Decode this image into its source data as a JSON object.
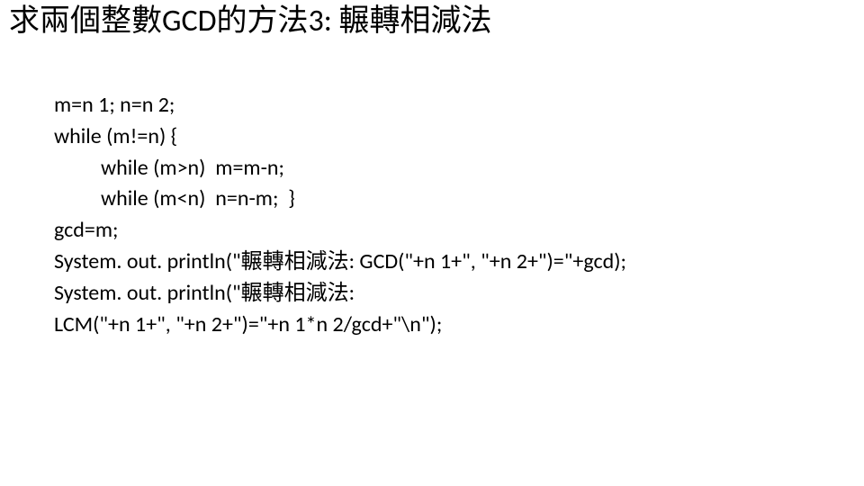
{
  "title": "求兩個整數GCD的方法3: 輾轉相減法",
  "code": {
    "l1": "m=n 1; n=n 2;",
    "l2": "while (m!=n) {",
    "l3": "while (m>n)  m=m-n;",
    "l4": "while (m<n)  n=n-m;  }",
    "l5": "gcd=m;",
    "l6": "System. out. println(\"輾轉相減法: GCD(\"+n 1+\", \"+n 2+\")=\"+gcd);",
    "l7": "System. out. println(\"輾轉相減法:",
    "l8": "LCM(\"+n 1+\", \"+n 2+\")=\"+n 1*n 2/gcd+\"\\n\");"
  }
}
